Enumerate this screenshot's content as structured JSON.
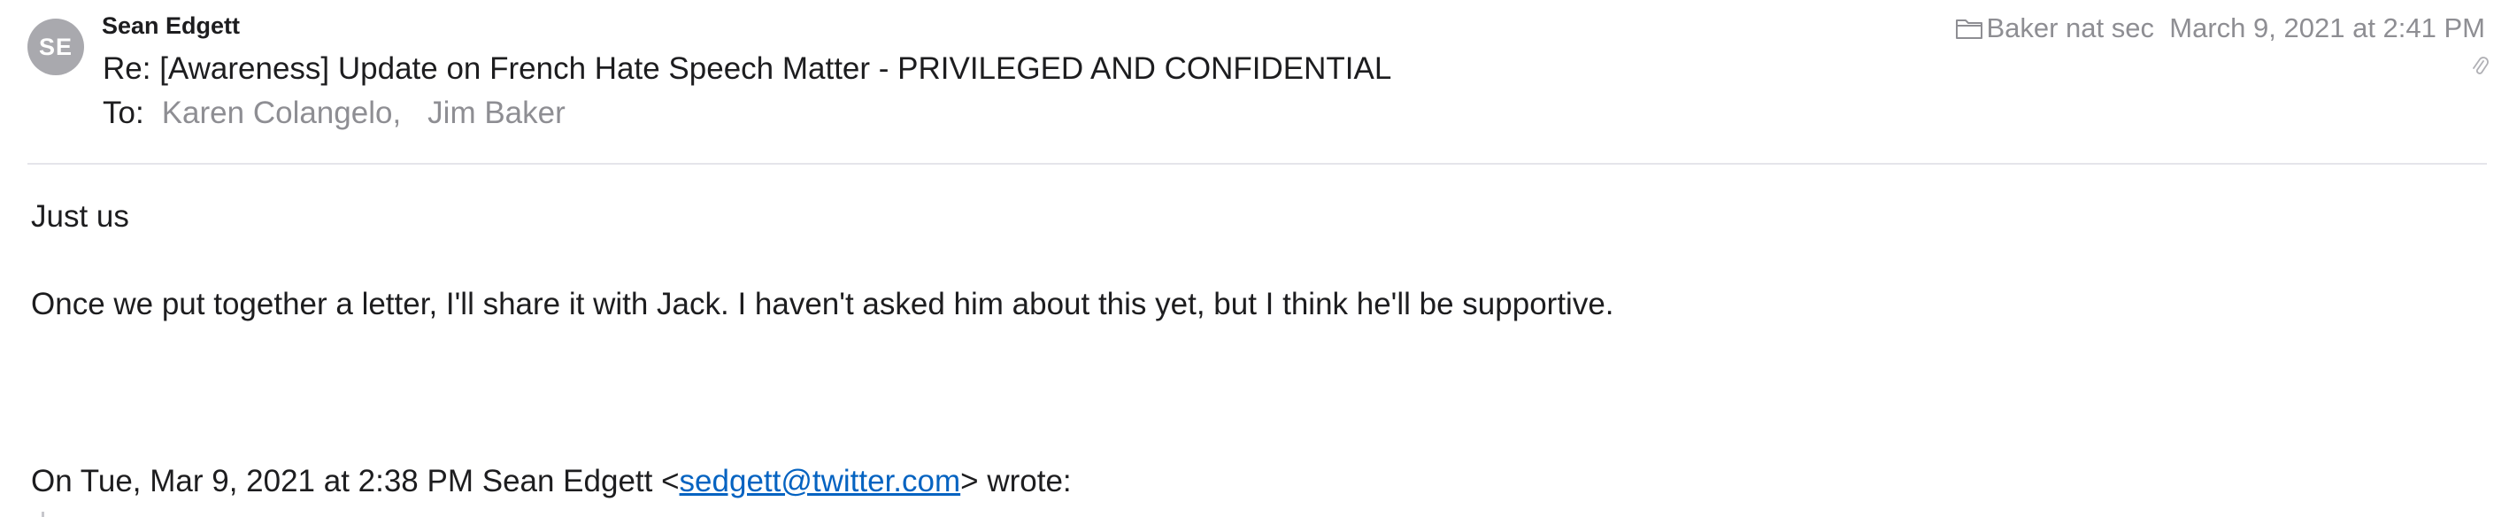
{
  "header": {
    "avatar_initials": "SE",
    "sender_name": "Sean Edgett",
    "subject": "Re: [Awareness] Update on French Hate Speech Matter - PRIVILEGED AND CONFIDENTIAL",
    "to_label": "To:",
    "recipients": [
      "Karen Colangelo,",
      "Jim Baker"
    ],
    "mailbox": "Baker nat sec",
    "datetime": "March 9, 2021 at 2:41 PM",
    "icons": {
      "mailbox": "folder-icon",
      "attachment": "paperclip-icon"
    }
  },
  "body": {
    "line1": "Just us",
    "line2": "Once we put together a letter, I'll share it with Jack. I haven't asked him about this yet, but I think he'll be supportive.",
    "quote_prefix": "On Tue, Mar 9, 2021 at 2:38 PM Sean Edgett <",
    "quote_email": "sedgett@twitter.com",
    "quote_suffix": "> wrote:"
  },
  "colors": {
    "avatar_bg": "#a9a9ae",
    "secondary_text": "#8e8e93",
    "link": "#0563c1",
    "divider": "#e5e5ea"
  }
}
